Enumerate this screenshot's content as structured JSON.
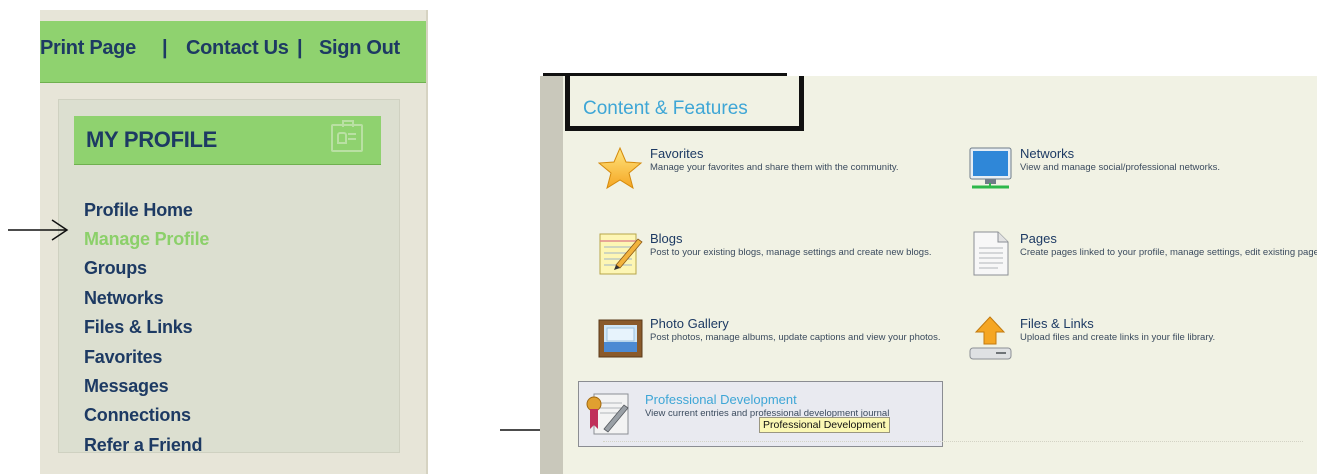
{
  "top_links": [
    {
      "label": "Print Page"
    },
    {
      "label": "Contact Us"
    },
    {
      "label": "Sign Out"
    }
  ],
  "separator": "|",
  "profile": {
    "title": "MY PROFILE",
    "icon": "id-card-icon",
    "items": [
      {
        "label": "Profile Home"
      },
      {
        "label": "Manage Profile",
        "active": true
      },
      {
        "label": "Groups"
      },
      {
        "label": "Networks"
      },
      {
        "label": "Files & Links"
      },
      {
        "label": "Favorites"
      },
      {
        "label": "Messages"
      },
      {
        "label": "Connections"
      },
      {
        "label": "Refer a Friend"
      }
    ]
  },
  "content": {
    "title": "Content & Features",
    "features": [
      {
        "title": "Favorites",
        "desc": "Manage your favorites and share them with the community.",
        "icon": "star-icon"
      },
      {
        "title": "Networks",
        "desc": "View and manage social/professional networks.",
        "icon": "monitor-network-icon"
      },
      {
        "title": "Blogs",
        "desc": "Post to your existing blogs, manage settings and create new blogs.",
        "icon": "notepad-pencil-icon"
      },
      {
        "title": "Pages",
        "desc": "Create pages linked to your profile, manage settings, edit existing pages.",
        "icon": "document-icon"
      },
      {
        "title": "Photo Gallery",
        "desc": "Post photos, manage albums, update captions and view your photos.",
        "icon": "photo-frame-icon"
      },
      {
        "title": "Files & Links",
        "desc": "Upload files and create links in your file library.",
        "icon": "upload-drive-icon"
      },
      {
        "title": "Professional Development",
        "desc": "View current entries and professional development journal",
        "icon": "certificate-icon"
      }
    ],
    "tooltip": "Professional Development"
  },
  "colors": {
    "accent_green": "#8fd26f",
    "link_navy": "#1d3a63",
    "active_green": "#8cd06a",
    "title_blue": "#3ea6d6"
  }
}
